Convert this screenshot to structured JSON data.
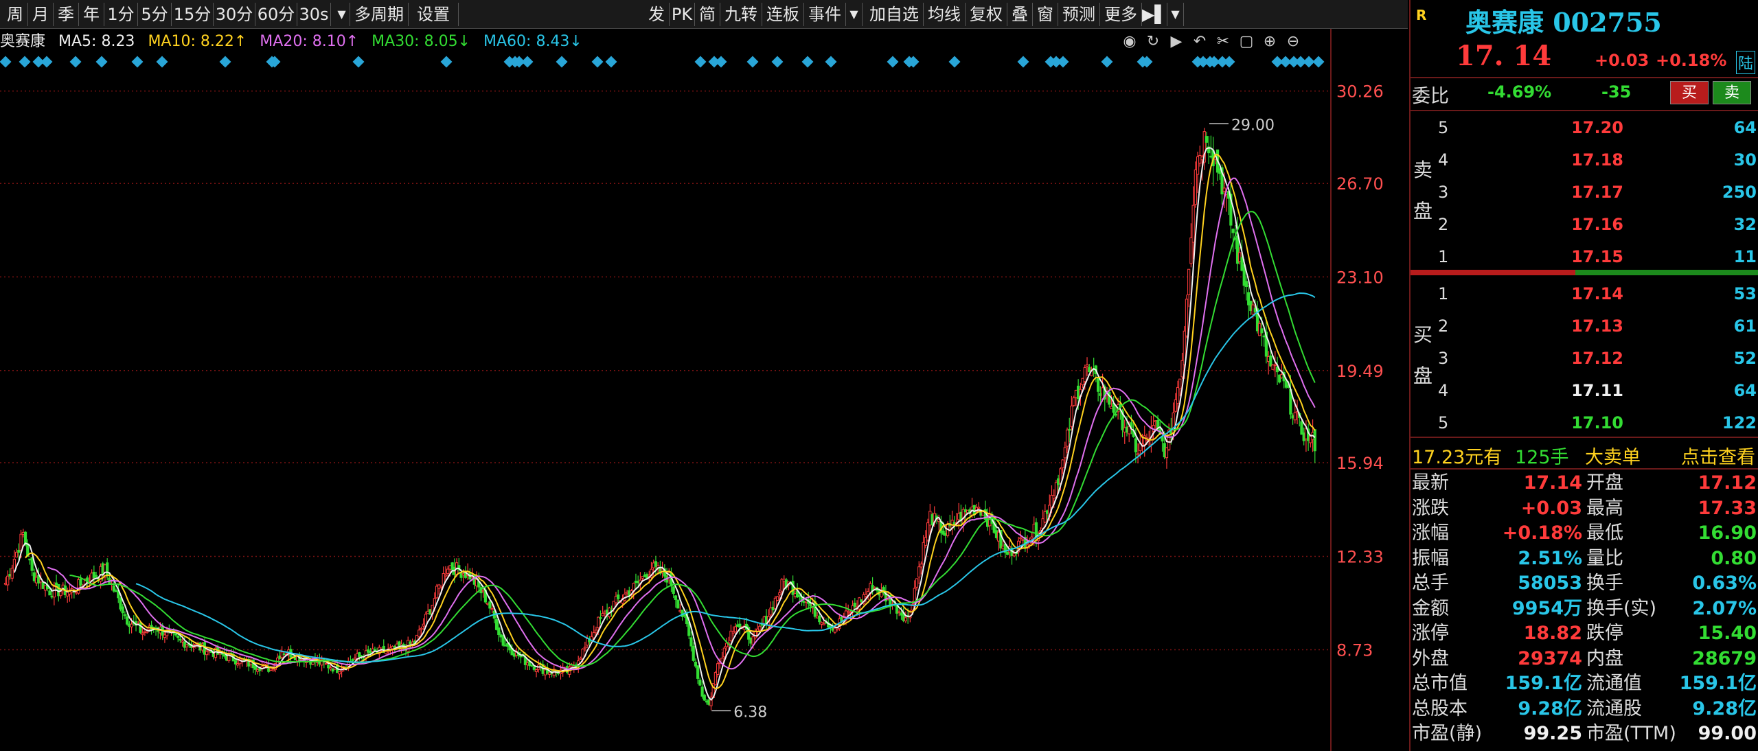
{
  "toolbar": {
    "items": [
      "周",
      "月",
      "季",
      "年",
      "1分",
      "5分",
      "15分",
      "30分",
      "60分",
      "30s",
      "▼",
      "多周期",
      "设置",
      "发",
      "PK",
      "简",
      "九转",
      "连板",
      "事件",
      "▼",
      "加自选",
      "均线",
      "复权",
      "叠",
      "窗",
      "预测",
      "更多",
      "▶▌",
      "▼"
    ]
  },
  "legend": {
    "name": "奥赛康",
    "ma5": "MA5: 8.23",
    "ma10": "MA10: 8.22↑",
    "ma20": "MA20: 8.10↑",
    "ma30": "MA30: 8.05↓",
    "ma60": "MA60: 8.43↓"
  },
  "colors": {
    "up": "#ff3b3b",
    "down": "#33dd33",
    "ma5": "#f0f0f0",
    "ma10": "#ffd21f",
    "ma20": "#e070f0",
    "ma30": "#33dd33",
    "ma60": "#29c6e8",
    "grid": "#7a1212",
    "axis": "#ff5050",
    "diamond": "#29a6d8"
  },
  "chart_icons": [
    "eye-icon",
    "refresh-icon",
    "play-icon",
    "undo-icon",
    "scissors-icon",
    "lock-icon",
    "zoom-in-icon",
    "zoom-out-icon"
  ],
  "chart_icon_glyphs": [
    "◉",
    "↻",
    "▶",
    "↶",
    "✂",
    "▢",
    "⊕",
    "⊖"
  ],
  "chart_data": {
    "type": "candlestick",
    "y_ticks": [
      "30.26",
      "26.70",
      "23.10",
      "19.49",
      "15.94",
      "12.33",
      "8.73"
    ],
    "y_tick_values": [
      30.26,
      26.7,
      23.1,
      19.49,
      15.94,
      12.33,
      8.73
    ],
    "ylim": [
      5.2,
      31.6
    ],
    "max_label": "29.00",
    "min_label": "6.38",
    "max_value": 29.0,
    "min_value": 6.38,
    "anchors": [
      [
        0,
        11.3
      ],
      [
        8,
        13.2
      ],
      [
        12,
        11.7
      ],
      [
        20,
        11.0
      ],
      [
        30,
        11.0
      ],
      [
        38,
        11.5
      ],
      [
        45,
        11.8
      ],
      [
        55,
        9.9
      ],
      [
        62,
        9.4
      ],
      [
        68,
        9.6
      ],
      [
        78,
        9.1
      ],
      [
        85,
        8.9
      ],
      [
        95,
        8.6
      ],
      [
        110,
        8.2
      ],
      [
        120,
        8.0
      ],
      [
        125,
        8.7
      ],
      [
        132,
        8.5
      ],
      [
        140,
        8.3
      ],
      [
        150,
        8.0
      ],
      [
        158,
        8.4
      ],
      [
        165,
        8.6
      ],
      [
        175,
        8.7
      ],
      [
        185,
        9.0
      ],
      [
        192,
        10.3
      ],
      [
        200,
        12.0
      ],
      [
        210,
        11.6
      ],
      [
        218,
        10.6
      ],
      [
        225,
        9.0
      ],
      [
        235,
        8.3
      ],
      [
        245,
        7.9
      ],
      [
        255,
        7.9
      ],
      [
        262,
        8.8
      ],
      [
        268,
        9.8
      ],
      [
        275,
        10.5
      ],
      [
        285,
        11.2
      ],
      [
        292,
        11.9
      ],
      [
        300,
        11.5
      ],
      [
        308,
        9.6
      ],
      [
        315,
        7.0
      ],
      [
        318,
        6.6
      ],
      [
        322,
        8.2
      ],
      [
        330,
        9.8
      ],
      [
        338,
        9.1
      ],
      [
        345,
        10.1
      ],
      [
        352,
        11.4
      ],
      [
        360,
        10.8
      ],
      [
        368,
        10.0
      ],
      [
        375,
        9.6
      ],
      [
        385,
        10.5
      ],
      [
        392,
        11.2
      ],
      [
        400,
        10.6
      ],
      [
        408,
        9.9
      ],
      [
        418,
        13.9
      ],
      [
        425,
        13.2
      ],
      [
        432,
        13.9
      ],
      [
        440,
        14.3
      ],
      [
        447,
        13.4
      ],
      [
        452,
        12.4
      ],
      [
        460,
        12.9
      ],
      [
        468,
        13.5
      ],
      [
        478,
        15.9
      ],
      [
        483,
        18.3
      ],
      [
        488,
        19.6
      ],
      [
        495,
        18.8
      ],
      [
        505,
        17.6
      ],
      [
        512,
        16.4
      ],
      [
        520,
        17.3
      ],
      [
        525,
        16.3
      ],
      [
        532,
        20.0
      ],
      [
        538,
        27.5
      ],
      [
        543,
        28.7
      ],
      [
        550,
        26.8
      ],
      [
        558,
        23.6
      ],
      [
        565,
        21.6
      ],
      [
        572,
        19.6
      ],
      [
        578,
        18.9
      ],
      [
        585,
        17.3
      ],
      [
        592,
        16.7
      ]
    ],
    "ma_periods": [
      5,
      10,
      20,
      30,
      60
    ]
  },
  "panel": {
    "title": "奥赛康 002755",
    "r_badge": "R",
    "price": "17. 14",
    "change": "+0.03",
    "change_pct": "+0.18%",
    "lu_badge": "陆",
    "weibi_label": "委比",
    "weibi_pct": "-4.69%",
    "weibi_diff": "-35",
    "buy_btn": "买",
    "sell_btn": "卖",
    "ask_label": "卖 盘",
    "bid_label": "买 盘",
    "asks": [
      {
        "lv": "5",
        "price": "17.20",
        "vol": "64",
        "c": "red"
      },
      {
        "lv": "4",
        "price": "17.18",
        "vol": "30",
        "c": "red"
      },
      {
        "lv": "3",
        "price": "17.17",
        "vol": "250",
        "c": "red"
      },
      {
        "lv": "2",
        "price": "17.16",
        "vol": "32",
        "c": "red"
      },
      {
        "lv": "1",
        "price": "17.15",
        "vol": "11",
        "c": "red"
      }
    ],
    "bids": [
      {
        "lv": "1",
        "price": "17.14",
        "vol": "53",
        "c": "red"
      },
      {
        "lv": "2",
        "price": "17.13",
        "vol": "61",
        "c": "red"
      },
      {
        "lv": "3",
        "price": "17.12",
        "vol": "52",
        "c": "red"
      },
      {
        "lv": "4",
        "price": "17.11",
        "vol": "64",
        "c": "white"
      },
      {
        "lv": "5",
        "price": "17.10",
        "vol": "122",
        "c": "green"
      }
    ],
    "bigorder": {
      "price": "17.23元有",
      "qty": "125手",
      "type": "大卖单",
      "link": "点击查看"
    },
    "stats": [
      [
        "最新",
        "17.14",
        "red",
        "开盘",
        "17.12",
        "red"
      ],
      [
        "涨跌",
        "+0.03",
        "red",
        "最高",
        "17.33",
        "red"
      ],
      [
        "涨幅",
        "+0.18%",
        "red",
        "最低",
        "16.90",
        "green"
      ],
      [
        "振幅",
        "2.51%",
        "cyan",
        "量比",
        "0.80",
        "green"
      ],
      [
        "总手",
        "58053",
        "cyan",
        "换手",
        "0.63%",
        "cyan"
      ],
      [
        "金额",
        "9954万",
        "cyan",
        "换手(实)",
        "2.07%",
        "cyan"
      ],
      [
        "涨停",
        "18.82",
        "red",
        "跌停",
        "15.40",
        "green"
      ],
      [
        "外盘",
        "29374",
        "red",
        "内盘",
        "28679",
        "green"
      ],
      [
        "总市值",
        "159.1亿",
        "cyan",
        "流通值",
        "159.1亿",
        "cyan"
      ],
      [
        "总股本",
        "9.28亿",
        "cyan",
        "流通股",
        "9.28亿",
        "cyan"
      ],
      [
        "市盈(静)",
        "99.25",
        "white",
        "市盈(TTM)",
        "99.00",
        "white"
      ]
    ]
  }
}
